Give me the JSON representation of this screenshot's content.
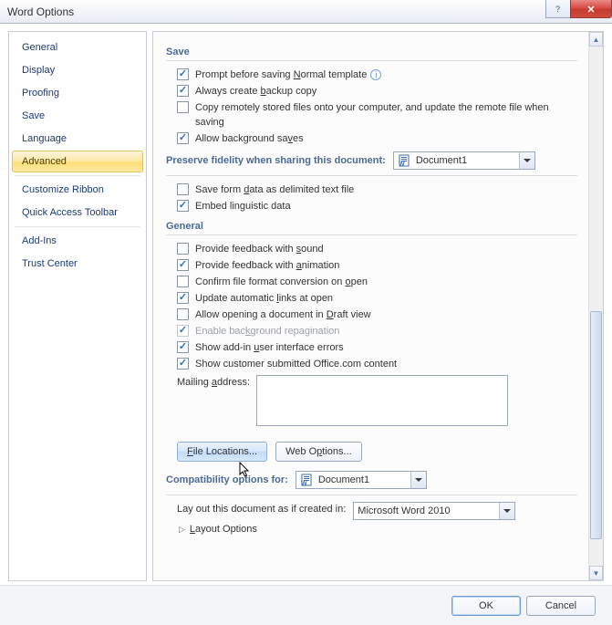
{
  "window": {
    "title": "Word Options"
  },
  "sidebar": {
    "items": [
      {
        "label": "General"
      },
      {
        "label": "Display"
      },
      {
        "label": "Proofing"
      },
      {
        "label": "Save"
      },
      {
        "label": "Language"
      },
      {
        "label": "Advanced"
      },
      {
        "label": "Customize Ribbon"
      },
      {
        "label": "Quick Access Toolbar"
      },
      {
        "label": "Add-Ins"
      },
      {
        "label": "Trust Center"
      }
    ],
    "selected_index": 5
  },
  "sections": {
    "save": {
      "title": "Save",
      "opts": [
        {
          "label_pre": "Prompt before saving ",
          "u": "N",
          "label_post": "ormal template",
          "checked": true,
          "info": true
        },
        {
          "label_pre": "Always create ",
          "u": "b",
          "label_post": "ackup copy",
          "checked": true
        },
        {
          "label_pre": "Copy remotely stored files onto your computer, and update the remote file when saving",
          "u": "",
          "label_post": "",
          "checked": false
        },
        {
          "label_pre": "Allow background sa",
          "u": "v",
          "label_post": "es",
          "checked": true
        }
      ]
    },
    "preserve": {
      "title": "Preserve fidelity when sharing this document:",
      "doc": "Document1",
      "opts": [
        {
          "label_pre": "Save form ",
          "u": "d",
          "label_post": "ata as delimited text file",
          "checked": false
        },
        {
          "label_pre": "Embed lin",
          "u": "g",
          "label_post": "uistic data",
          "checked": true
        }
      ]
    },
    "general": {
      "title": "General",
      "opts": [
        {
          "label_pre": "Provide feedback with ",
          "u": "s",
          "label_post": "ound",
          "checked": false
        },
        {
          "label_pre": "Provide feedback with ",
          "u": "a",
          "label_post": "nimation",
          "checked": true
        },
        {
          "label_pre": "Confirm file format conversion on ",
          "u": "o",
          "label_post": "pen",
          "checked": false
        },
        {
          "label_pre": "Update automatic ",
          "u": "l",
          "label_post": "inks at open",
          "checked": true
        },
        {
          "label_pre": "Allow opening a document in ",
          "u": "D",
          "label_post": "raft view",
          "checked": false
        },
        {
          "label_pre": "Enable bac",
          "u": "k",
          "label_post": "ground repagination",
          "checked": true,
          "disabled": true
        },
        {
          "label_pre": "Show add-in ",
          "u": "u",
          "label_post": "ser interface errors",
          "checked": true
        },
        {
          "label_pre": "Show customer submitted Office.com content",
          "u": "",
          "label_post": "",
          "checked": true
        }
      ],
      "mailing_label": "Mailing address:",
      "mailing_value": "",
      "file_locations_btn": "File Locations...",
      "web_options_btn": "Web Options..."
    },
    "compat": {
      "title": "Compatibility options for:",
      "doc": "Document1",
      "layout_label_pre": "Lay out this document as if created in:",
      "layout_value": "Microsoft Word 2010",
      "layout_options": "Layout Options"
    }
  },
  "footer": {
    "ok": "OK",
    "cancel": "Cancel"
  }
}
